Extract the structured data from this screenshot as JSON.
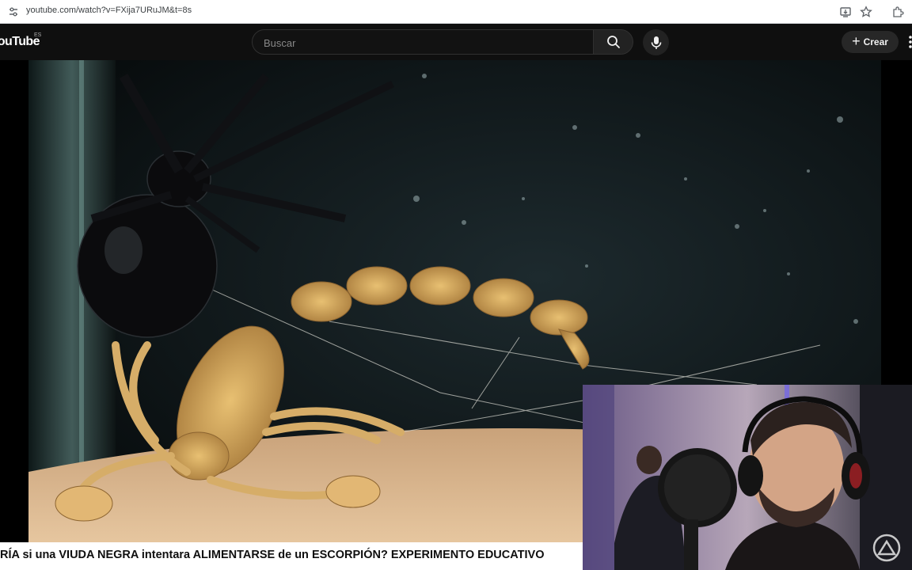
{
  "browser": {
    "url": "youtube.com/watch?v=FXija7URuJM&t=8s",
    "icons": [
      "site-settings-icon",
      "install-app-icon",
      "bookmark-star-icon",
      "extensions-icon"
    ]
  },
  "header": {
    "logo_text": "YouTube",
    "region": "ES",
    "search_placeholder": "Buscar",
    "search_icon": "search-icon",
    "mic_icon": "microphone-icon",
    "create_label": "Crear",
    "create_icon": "plus-icon"
  },
  "video": {
    "title": "RÍA si una VIUDA NEGRA intentara ALIMENTARSE de un ESCORPIÓN? EXPERIMENTO EDUCATIVO",
    "scene": "black widow spider and yellow scorpion in a glass terrarium",
    "webcam_scene": "streamer wearing headphones in front of a microphone, second person at a desk behind"
  },
  "colors": {
    "header_bg": "#0f0f0f",
    "search_bg": "#121212",
    "button_bg": "#272727",
    "title_text": "#0f0f0f"
  }
}
